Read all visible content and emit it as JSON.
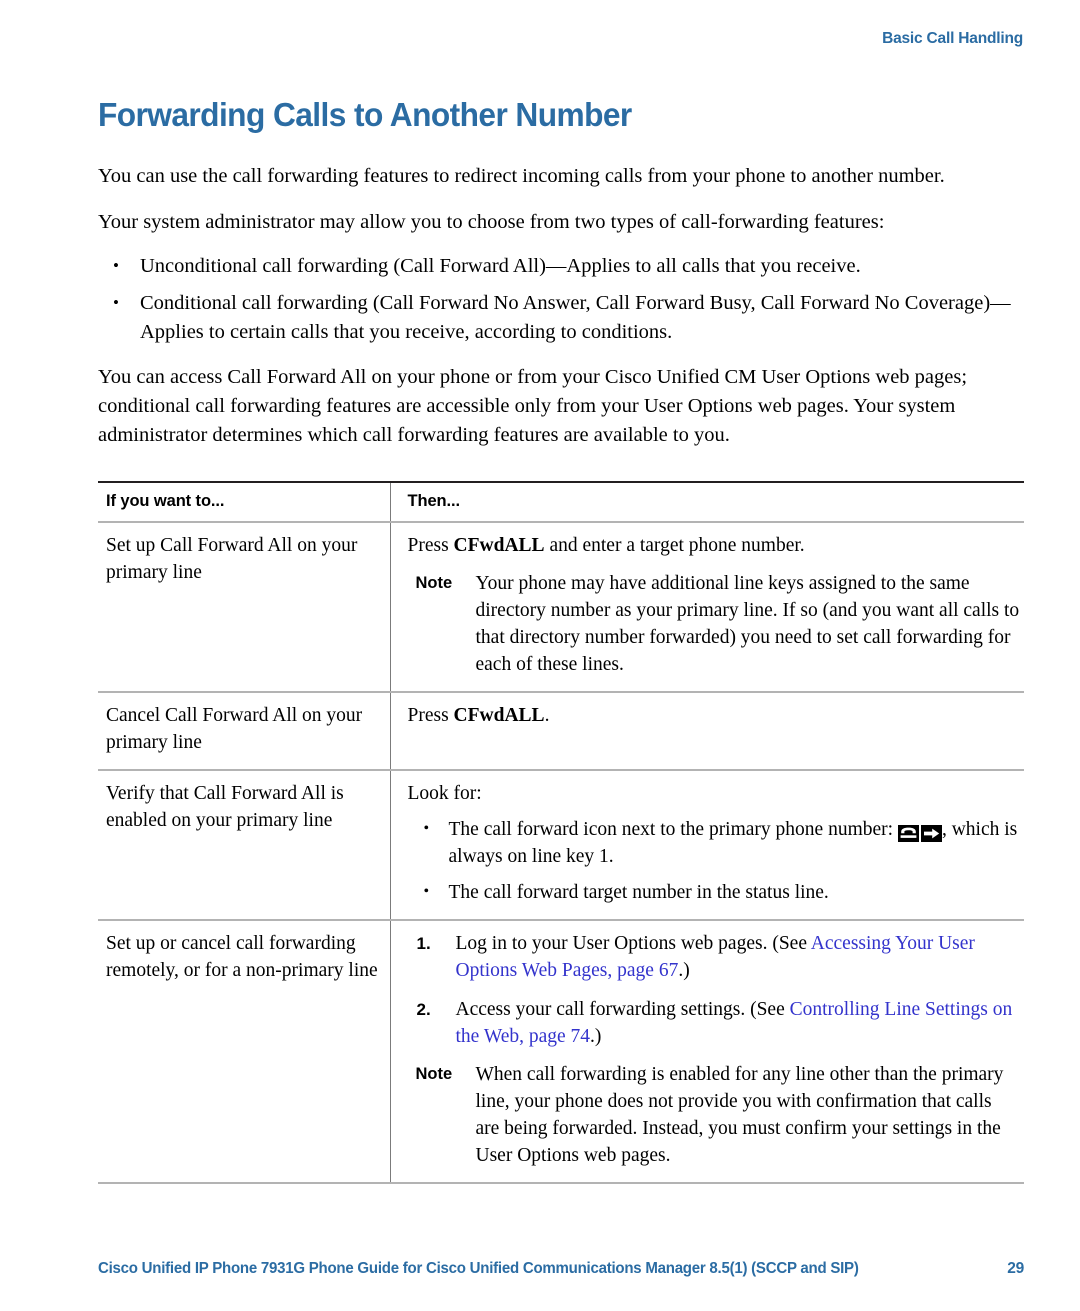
{
  "running_head": "Basic Call Handling",
  "title": "Forwarding Calls to Another Number",
  "intro": {
    "para1": "You can use the call forwarding features to redirect incoming calls from your phone to another number.",
    "para2": "Your system administrator may allow you to choose from two types of call-forwarding features:",
    "bullets": [
      "Unconditional call forwarding (Call Forward All)—Applies to all calls that you receive.",
      "Conditional call forwarding (Call Forward No Answer, Call Forward Busy, Call Forward No Coverage)—Applies to certain calls that you receive, according to conditions."
    ],
    "para3": "You can access Call Forward All on your phone or from your Cisco Unified CM User Options web pages; conditional call forwarding features are accessible only from your User Options web pages. Your system administrator determines which call forwarding features are available to you."
  },
  "table": {
    "headers": {
      "col1": "If you want to...",
      "col2": "Then..."
    },
    "rows": {
      "row1": {
        "action": "Set up Call Forward All on your primary line",
        "instruction_pre": "Press ",
        "instruction_bold": "CFwdALL",
        "instruction_post": " and enter a target phone number.",
        "note_label": "Note",
        "note_text": "Your phone may have additional line keys assigned to the same directory number as your primary line. If so (and you want all calls to that directory number forwarded) you need to set call forwarding for each of these lines."
      },
      "row2": {
        "action": "Cancel Call Forward All on your primary line",
        "instruction_pre": "Press ",
        "instruction_bold": "CFwdALL",
        "instruction_post": "."
      },
      "row3": {
        "action": "Verify that Call Forward All is enabled on your primary line",
        "lead": "Look for:",
        "bullet1_pre": "The call forward icon next to the primary phone number: ",
        "bullet1_post": ", which is always on line key 1.",
        "bullet1_icon": "call-forward-icon",
        "bullet2": "The call forward target number in the status line."
      },
      "row4": {
        "action": "Set up or cancel call forwarding remotely, or for a non-primary line",
        "step1_pre": "Log in to your User Options web pages. (See ",
        "step1_link": "Accessing Your User Options Web Pages, page 67",
        "step1_post": ".)",
        "step1_num": "1.",
        "step2_pre": "Access your call forwarding settings. (See ",
        "step2_link": "Controlling Line Settings on the Web, page 74",
        "step2_post": ".)",
        "step2_num": "2.",
        "note_label": "Note",
        "note_text": "When call forwarding is enabled for any line other than the primary line, your phone does not provide you with confirmation that calls are being forwarded. Instead, you must confirm your settings in the User Options web pages."
      }
    }
  },
  "footer": {
    "title": "Cisco Unified IP Phone 7931G Phone Guide for Cisco Unified Communications Manager 8.5(1) (SCCP and SIP)",
    "page_number": "29"
  },
  "colors": {
    "heading_blue": "#2B6CA3",
    "link_blue": "#3333CC",
    "rule_dark": "#231f20",
    "rule_light": "#b3b3b3"
  }
}
